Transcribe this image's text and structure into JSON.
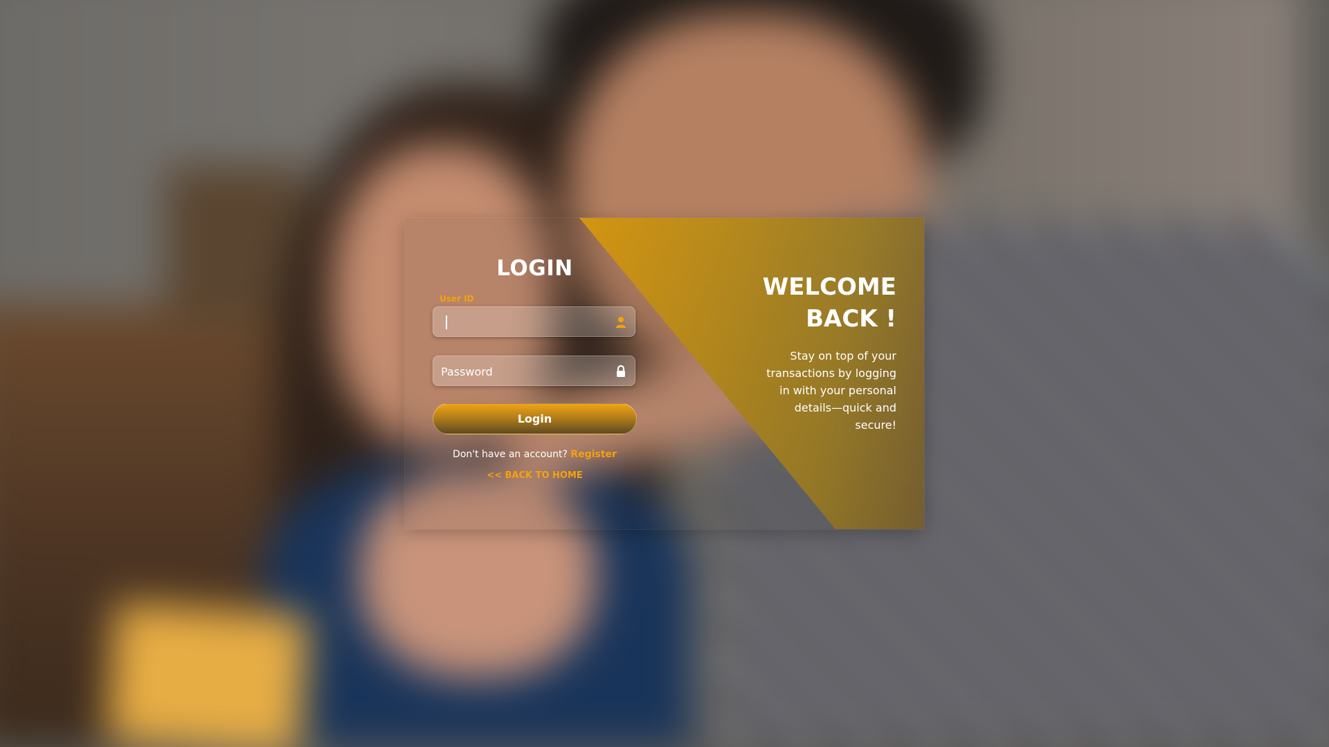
{
  "login": {
    "title": "LOGIN",
    "userid_label": "User ID",
    "userid_value": "",
    "password_placeholder": "Password",
    "login_button": "Login",
    "register_prompt": "Don't have an account?",
    "register_link": "Register",
    "back_home": "<< BACK TO HOME"
  },
  "welcome": {
    "title_line1": "WELCOME",
    "title_line2": "BACK !",
    "text": "Stay on top of your transactions by logging in with your personal details—quick and secure!"
  },
  "colors": {
    "accent": "#f5a10f",
    "panel_gradient_start": "#e19b10",
    "panel_gradient_end": "#7a6232"
  },
  "icons": {
    "userid": "user-icon",
    "password": "lock-icon"
  }
}
